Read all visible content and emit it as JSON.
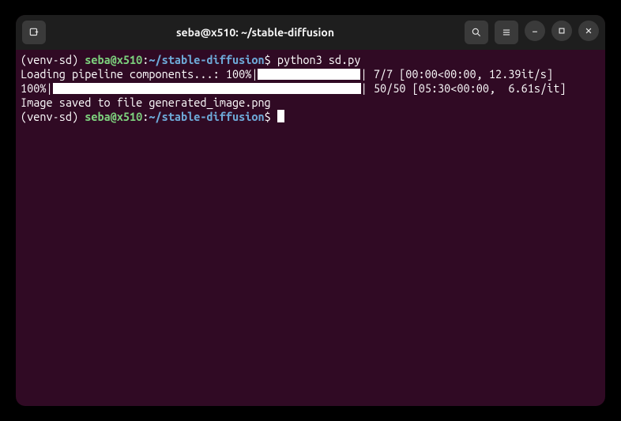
{
  "titlebar": {
    "title": "seba@x510: ~/stable-diffusion"
  },
  "prompt": {
    "venv": "(venv-sd) ",
    "user": "seba@x510",
    "colon": ":",
    "path": "~/stable-diffusion",
    "ps": "$ "
  },
  "lines": {
    "cmd1": "python3 sd.py",
    "load_prefix": "Loading pipeline components...: 100%|",
    "load_suffix": "| 7/7 [00:00<00:00, 12.39it/s]",
    "gen_prefix": "100%|",
    "gen_suffix": "| 50/50 [05:30<00:00,  6.61s/it]",
    "saved": "Image saved to file generated_image.png"
  }
}
